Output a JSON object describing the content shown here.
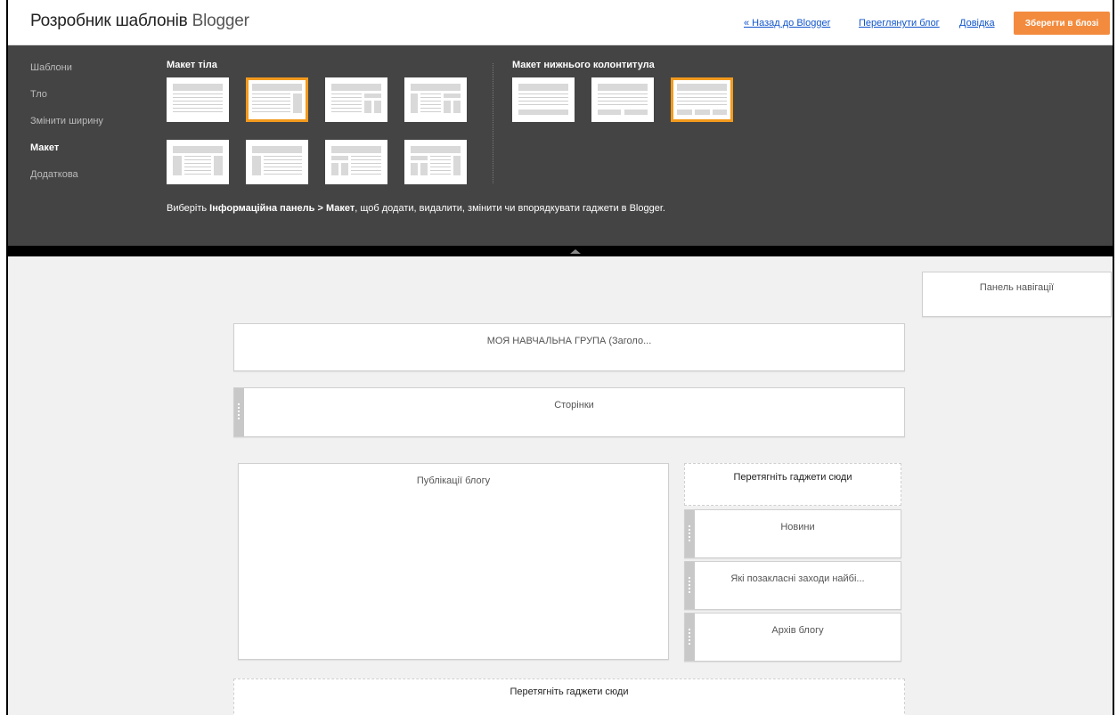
{
  "header": {
    "title_bold": "Розробник шаблонів",
    "title_light": "Blogger",
    "links": [
      "« Назад до Blogger",
      "Переглянути блог",
      "Довідка"
    ],
    "save_label": "Зберегти в блозі"
  },
  "sidebar": {
    "items": [
      {
        "label": "Шаблони"
      },
      {
        "label": "Тло"
      },
      {
        "label": "Змінити ширину"
      },
      {
        "label": "Макет"
      },
      {
        "label": "Додаткова"
      }
    ]
  },
  "layout_panel": {
    "body_title": "Макет тіла",
    "footer_title": "Макет нижнього колонтитула",
    "hint_prefix": "Виберіть ",
    "hint_bold": "Інформаційна панель > Макет",
    "hint_suffix": ", щоб додати, видалити, змінити чи впорядкувати гаджети в Blogger."
  },
  "canvas": {
    "navbar": "Панель навігації",
    "header_gadget": "МОЯ НАВЧАЛЬНА ГРУПА (Заголо...",
    "pages_gadget": "Сторінки",
    "posts_gadget": "Публікації блогу",
    "sidebar_drop": "Перетягніть гаджети сюди",
    "sidebar_gadgets": [
      "Новини",
      "Які позакласні заходи найбі...",
      "Архів блогу"
    ],
    "footer_drop": "Перетягніть гаджети сюди"
  },
  "colors": {
    "accent": "#f39a1d",
    "save_button": "#f38b3e",
    "panel_bg": "#444444",
    "link": "#1155cc"
  }
}
